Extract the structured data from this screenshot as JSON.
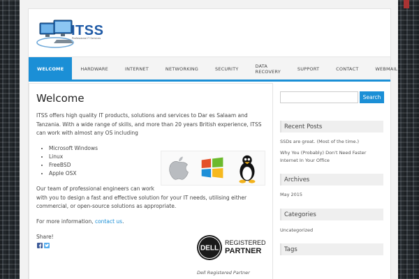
{
  "site": {
    "logo_text": "ITSS",
    "logo_subtext": "Professional IT Services"
  },
  "nav": {
    "items": [
      "Welcome",
      "Hardware",
      "Internet",
      "Networking",
      "Security",
      "Data Recovery",
      "Support",
      "Contact",
      "Webmail"
    ],
    "active_index": 0
  },
  "main": {
    "title": "Welcome",
    "intro": "ITSS offers high quality IT products, solutions and services to Dar es Salaam and Tanzania. With a wide range of skills, and more than 20 years British experience, ITSS can work with almost any OS including",
    "os_list": [
      "Microsoft Windows",
      "Linux",
      "FreeBSD",
      "Apple OSX"
    ],
    "team_text": "Our team of professional engineers can work\nwith you to design a fast and effective solution for your IT needs, utilising either commercial, or open-source solutions as appropriate.",
    "more_info_prefix": "For more information, ",
    "contact_link": "contact us",
    "more_info_suffix": ".",
    "share_label": "Share!",
    "dell_caption": "Dell Registered Partner"
  },
  "sidebar": {
    "search_placeholder": "",
    "search_button": "Search",
    "recent_posts_title": "Recent Posts",
    "recent_posts": [
      "SSDs are great. (Most of the time.)",
      "Why You (Probably) Don't Need Faster Internet In Your Office"
    ],
    "archives_title": "Archives",
    "archives": [
      "May 2015"
    ],
    "categories_title": "Categories",
    "categories": [
      "Uncategorized"
    ],
    "tags_title": "Tags"
  },
  "colors": {
    "accent": "#1b8fd6",
    "logo_blue": "#1f5aa6"
  }
}
